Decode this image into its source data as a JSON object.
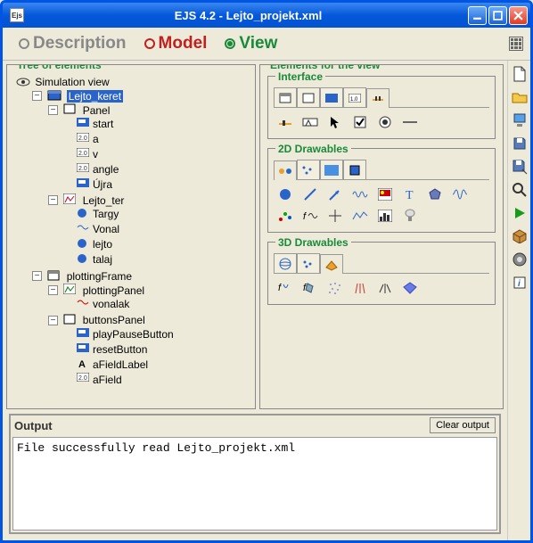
{
  "titlebar": {
    "icon_label": "Ejs",
    "title": "EJS 4.2 - Lejto_projekt.xml"
  },
  "tabs": {
    "description": "Description",
    "model": "Model",
    "view": "View"
  },
  "tree": {
    "legend": "Tree of elements",
    "root": "Simulation view",
    "items": [
      {
        "name": "Lejto_keret",
        "selected": true,
        "children": [
          {
            "name": "Panel",
            "children": [
              {
                "name": "start"
              },
              {
                "name": "a"
              },
              {
                "name": "v"
              },
              {
                "name": "angle"
              },
              {
                "name": "Újra"
              }
            ]
          },
          {
            "name": "Lejto_ter",
            "children": [
              {
                "name": "Targy"
              },
              {
                "name": "Vonal"
              },
              {
                "name": "lejto"
              },
              {
                "name": "talaj"
              }
            ]
          }
        ]
      },
      {
        "name": "plottingFrame",
        "children": [
          {
            "name": "plottingPanel",
            "children": [
              {
                "name": "vonalak"
              }
            ]
          },
          {
            "name": "buttonsPanel",
            "children": [
              {
                "name": "playPauseButton"
              },
              {
                "name": "resetButton"
              },
              {
                "name": "aFieldLabel"
              },
              {
                "name": "aField"
              }
            ]
          }
        ]
      }
    ]
  },
  "elements": {
    "legend": "Elements for the view",
    "sections": {
      "interface": "Interface",
      "d2": "2D Drawables",
      "d3": "3D Drawables"
    }
  },
  "output": {
    "title": "Output",
    "clear": "Clear output",
    "text": "File successfully read Lejto_projekt.xml\n"
  }
}
